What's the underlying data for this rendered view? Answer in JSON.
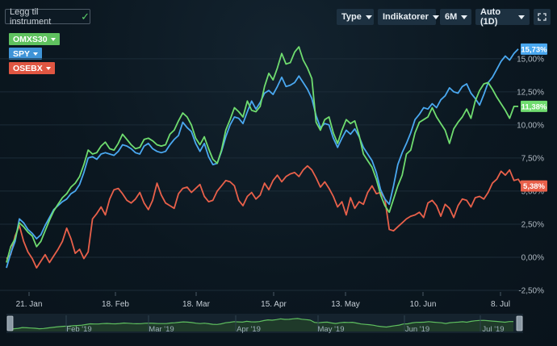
{
  "toolbar": {
    "add_instrument_label": "Legg til instrument",
    "type_label": "Type",
    "indicators_label": "Indikatorer",
    "range_label": "6M",
    "interval_label": "Auto (1D)"
  },
  "colors": {
    "green": "#6fdc6f",
    "blue": "#4aa8f0",
    "red": "#e8604a"
  },
  "chart_data": {
    "type": "line",
    "yunit": "%",
    "ylim": [
      -2.5,
      17.0
    ],
    "yticks": [
      "15,00%",
      "12,50%",
      "10,00%",
      "7,50%",
      "5,00%",
      "2,50%",
      "0,00%",
      "-2,50%"
    ],
    "xticks": [
      "21. Jan",
      "18. Feb",
      "18. Mar",
      "15. Apr",
      "13. May",
      "10. Jun",
      "8. Jul"
    ],
    "navigator_months": [
      "Feb '19",
      "Mar '19",
      "Apr '19",
      "May '19",
      "Jun '19",
      "Jul '19"
    ],
    "grid": true,
    "legend_position": "top-left",
    "series": [
      {
        "name": "OMXS30",
        "color": "#6fdc6f",
        "last_label": "11,38%",
        "values": [
          -0.4,
          0.8,
          1.4,
          2.6,
          2.3,
          1.9,
          1.6,
          0.8,
          1.2,
          2.0,
          2.8,
          3.5,
          4.0,
          4.5,
          4.8,
          5.3,
          5.6,
          6.1,
          7.0,
          8.1,
          7.8,
          7.9,
          8.4,
          8.7,
          8.2,
          8.1,
          8.6,
          9.3,
          8.9,
          8.5,
          8.2,
          8.3,
          8.9,
          9.0,
          8.8,
          8.5,
          8.4,
          8.5,
          9.3,
          9.6,
          10.3,
          10.9,
          10.6,
          10.0,
          9.0,
          8.5,
          9.1,
          8.2,
          7.4,
          7.1,
          8.1,
          9.6,
          10.4,
          11.3,
          11.0,
          10.6,
          11.8,
          11.1,
          11.0,
          11.4,
          12.9,
          13.9,
          13.4,
          14.3,
          15.4,
          14.6,
          14.7,
          15.5,
          15.9,
          14.9,
          14.3,
          13.5,
          10.2,
          9.6,
          10.4,
          10.6,
          9.4,
          8.6,
          9.6,
          10.4,
          10.1,
          10.3,
          9.2,
          7.8,
          7.3,
          6.8,
          5.9,
          4.7,
          3.9,
          3.4,
          4.4,
          5.4,
          6.2,
          7.8,
          8.1,
          9.4,
          10.2,
          10.4,
          10.6,
          11.3,
          10.6,
          10.1,
          9.6,
          8.6,
          9.7,
          10.2,
          10.6,
          11.2,
          10.5,
          11.8,
          12.6,
          13.1,
          13.2,
          12.7,
          12.1,
          11.6,
          11.1,
          10.5,
          11.4,
          11.4
        ]
      },
      {
        "name": "SPY",
        "color": "#4aa8f0",
        "last_label": "15,73%",
        "values": [
          -0.8,
          0.3,
          1.2,
          2.9,
          2.6,
          2.1,
          1.8,
          1.4,
          1.7,
          2.4,
          3.0,
          3.6,
          3.9,
          4.2,
          4.4,
          4.8,
          5.0,
          5.5,
          6.4,
          7.5,
          7.6,
          7.4,
          7.8,
          7.9,
          7.8,
          7.7,
          8.0,
          8.5,
          8.4,
          8.2,
          7.9,
          7.8,
          8.4,
          8.6,
          8.2,
          8.0,
          7.9,
          8.0,
          8.5,
          8.9,
          9.2,
          10.2,
          9.8,
          9.5,
          8.6,
          8.0,
          8.6,
          7.6,
          7.0,
          7.1,
          8.0,
          9.1,
          10.0,
          10.6,
          10.5,
          10.1,
          11.0,
          11.8,
          11.2,
          11.7,
          12.4,
          12.6,
          12.3,
          12.9,
          13.6,
          12.9,
          13.0,
          13.2,
          13.7,
          13.2,
          12.7,
          12.0,
          10.7,
          9.8,
          10.1,
          10.0,
          9.0,
          8.3,
          9.0,
          9.6,
          9.3,
          9.7,
          9.1,
          8.3,
          7.8,
          7.3,
          6.4,
          5.1,
          4.4,
          4.0,
          5.4,
          7.0,
          7.9,
          8.6,
          9.4,
          10.4,
          10.8,
          11.3,
          11.2,
          11.6,
          11.3,
          11.9,
          12.2,
          12.8,
          12.5,
          12.4,
          12.9,
          13.1,
          12.4,
          12.0,
          11.5,
          12.3,
          13.2,
          13.6,
          14.2,
          14.8,
          15.2,
          14.9,
          15.4,
          15.73
        ]
      },
      {
        "name": "OSEBX",
        "color": "#e8604a",
        "last_label": "5,38%",
        "values": [
          -0.1,
          0.2,
          1.6,
          2.4,
          1.2,
          0.4,
          -0.1,
          -0.8,
          -0.3,
          0.2,
          -0.4,
          0.1,
          0.6,
          1.2,
          2.2,
          1.4,
          0.3,
          0.6,
          -0.1,
          0.4,
          2.9,
          3.3,
          3.8,
          3.2,
          4.4,
          5.1,
          5.2,
          4.8,
          4.3,
          4.1,
          4.4,
          4.9,
          4.1,
          3.6,
          4.3,
          5.6,
          4.7,
          4.1,
          3.9,
          3.7,
          4.8,
          5.2,
          5.3,
          4.9,
          5.2,
          5.5,
          4.6,
          4.2,
          4.3,
          5.0,
          5.4,
          5.8,
          5.7,
          5.4,
          4.3,
          3.9,
          4.6,
          4.9,
          4.4,
          4.7,
          5.6,
          5.1,
          5.8,
          6.2,
          5.7,
          6.1,
          6.3,
          6.4,
          6.1,
          6.6,
          6.9,
          6.6,
          6.0,
          5.3,
          5.7,
          5.2,
          4.6,
          3.8,
          4.2,
          3.2,
          4.5,
          3.7,
          4.2,
          4.0,
          4.9,
          5.4,
          4.8,
          4.9,
          4.4,
          2.1,
          2.0,
          2.3,
          2.6,
          2.9,
          3.1,
          3.2,
          3.4,
          3.0,
          4.1,
          4.3,
          3.9,
          3.1,
          4.0,
          3.7,
          3.0,
          3.9,
          4.4,
          4.3,
          3.8,
          4.5,
          4.6,
          4.4,
          4.9,
          5.6,
          5.9,
          6.5,
          6.2,
          6.6,
          5.8,
          5.9,
          5.38
        ]
      }
    ]
  }
}
